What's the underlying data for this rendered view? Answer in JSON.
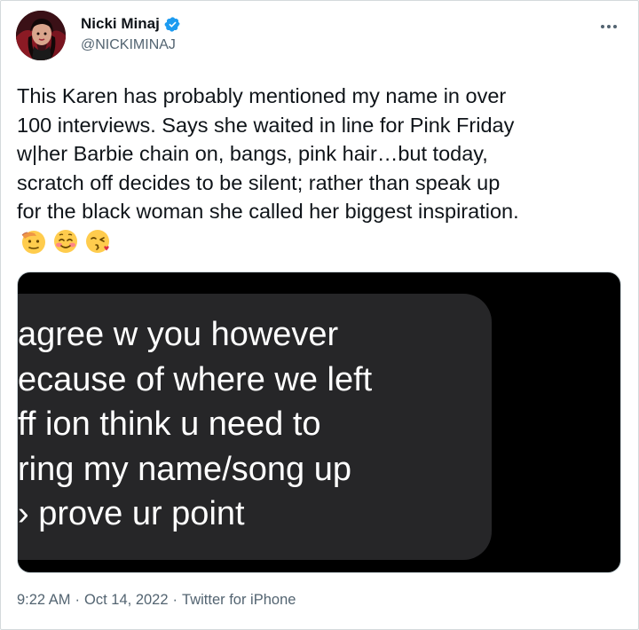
{
  "tweet": {
    "author": {
      "display_name": "Nicki Minaj",
      "handle": "@NICKIMINAJ",
      "verified": true,
      "verified_color": "#1d9bf0",
      "avatar_icon": "profile-photo"
    },
    "more_icon": "more-horizontal-icon",
    "text": "This Karen has probably mentioned my name in over\n100 interviews. Says she waited in line for Pink Friday\nw|her Barbie chain on, bangs, pink hair…but today,\nscratch off decides to be silent; rather than speak up\nfor the black woman she called her biggest inspiration.",
    "emojis": [
      "saluting-face",
      "smiling-face-with-smiling-eyes-blush",
      "face-blowing-a-kiss"
    ],
    "media": {
      "type": "screenshot-of-message",
      "bubble_color": "#262628",
      "lines": [
        "agree w you however",
        "ecause of where we left",
        "ff ion think u need to",
        "ring my name/song up",
        "› prove ur point"
      ]
    },
    "meta": {
      "time": "9:22 AM",
      "separator": "·",
      "date": "Oct 14, 2022",
      "source": "Twitter for iPhone"
    }
  }
}
